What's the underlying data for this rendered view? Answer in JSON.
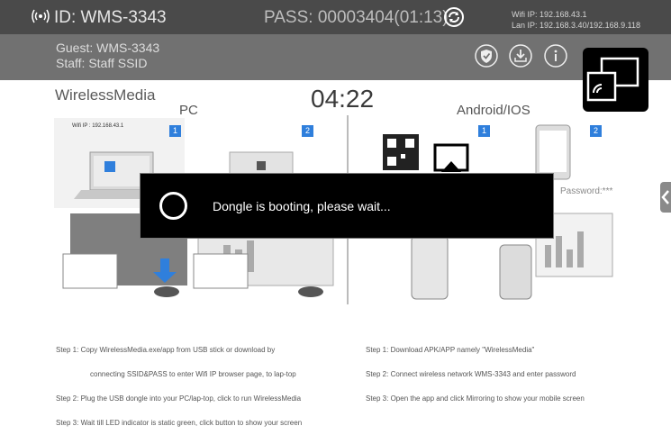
{
  "topbar": {
    "id_text": "ID: WMS-3343",
    "pass_text": "PASS: 00003404(01:13)",
    "wifi_ip": "Wifi IP: 192.168.43.1",
    "lan_ip": "Lan IP: 192.168.3.40/192.168.9.118"
  },
  "subbar": {
    "guest": "Guest: WMS-3343",
    "staff": "Staff: Staff SSID"
  },
  "main": {
    "brand": "WirelessMedia",
    "clock": "04:22",
    "pc_label": "PC",
    "android_label": "Android/IOS",
    "wifi_ip_small": "Wifi IP : 192.168.43.1",
    "password_hint": "Password:***"
  },
  "dialog": {
    "message": "Dongle is booting, please wait..."
  },
  "pc_steps": [
    "Step 1: Copy WirelessMedia.exe/app from USB stick or download by",
    "connecting SSID&PASS to enter Wifi IP browser page, to lap-top",
    "Step 2: Plug the USB dongle into your PC/lap-top, click to run WirelessMedia",
    "Step 3: Wait till LED indicator is static green, click button to show your screen"
  ],
  "mobile_steps": [
    "Step 1: Download APK/APP namely \"WirelessMedia\"",
    "Step 2: Connect wireless network WMS-3343 and enter password",
    "Step 3: Open the app and click Mirroring to show your mobile screen"
  ],
  "badges": [
    "1",
    "2",
    "1",
    "2"
  ],
  "colors": {
    "topbar": "#4a4a4a",
    "subbar": "#717171",
    "badge": "#2f7fdc",
    "dialog": "#000000"
  }
}
